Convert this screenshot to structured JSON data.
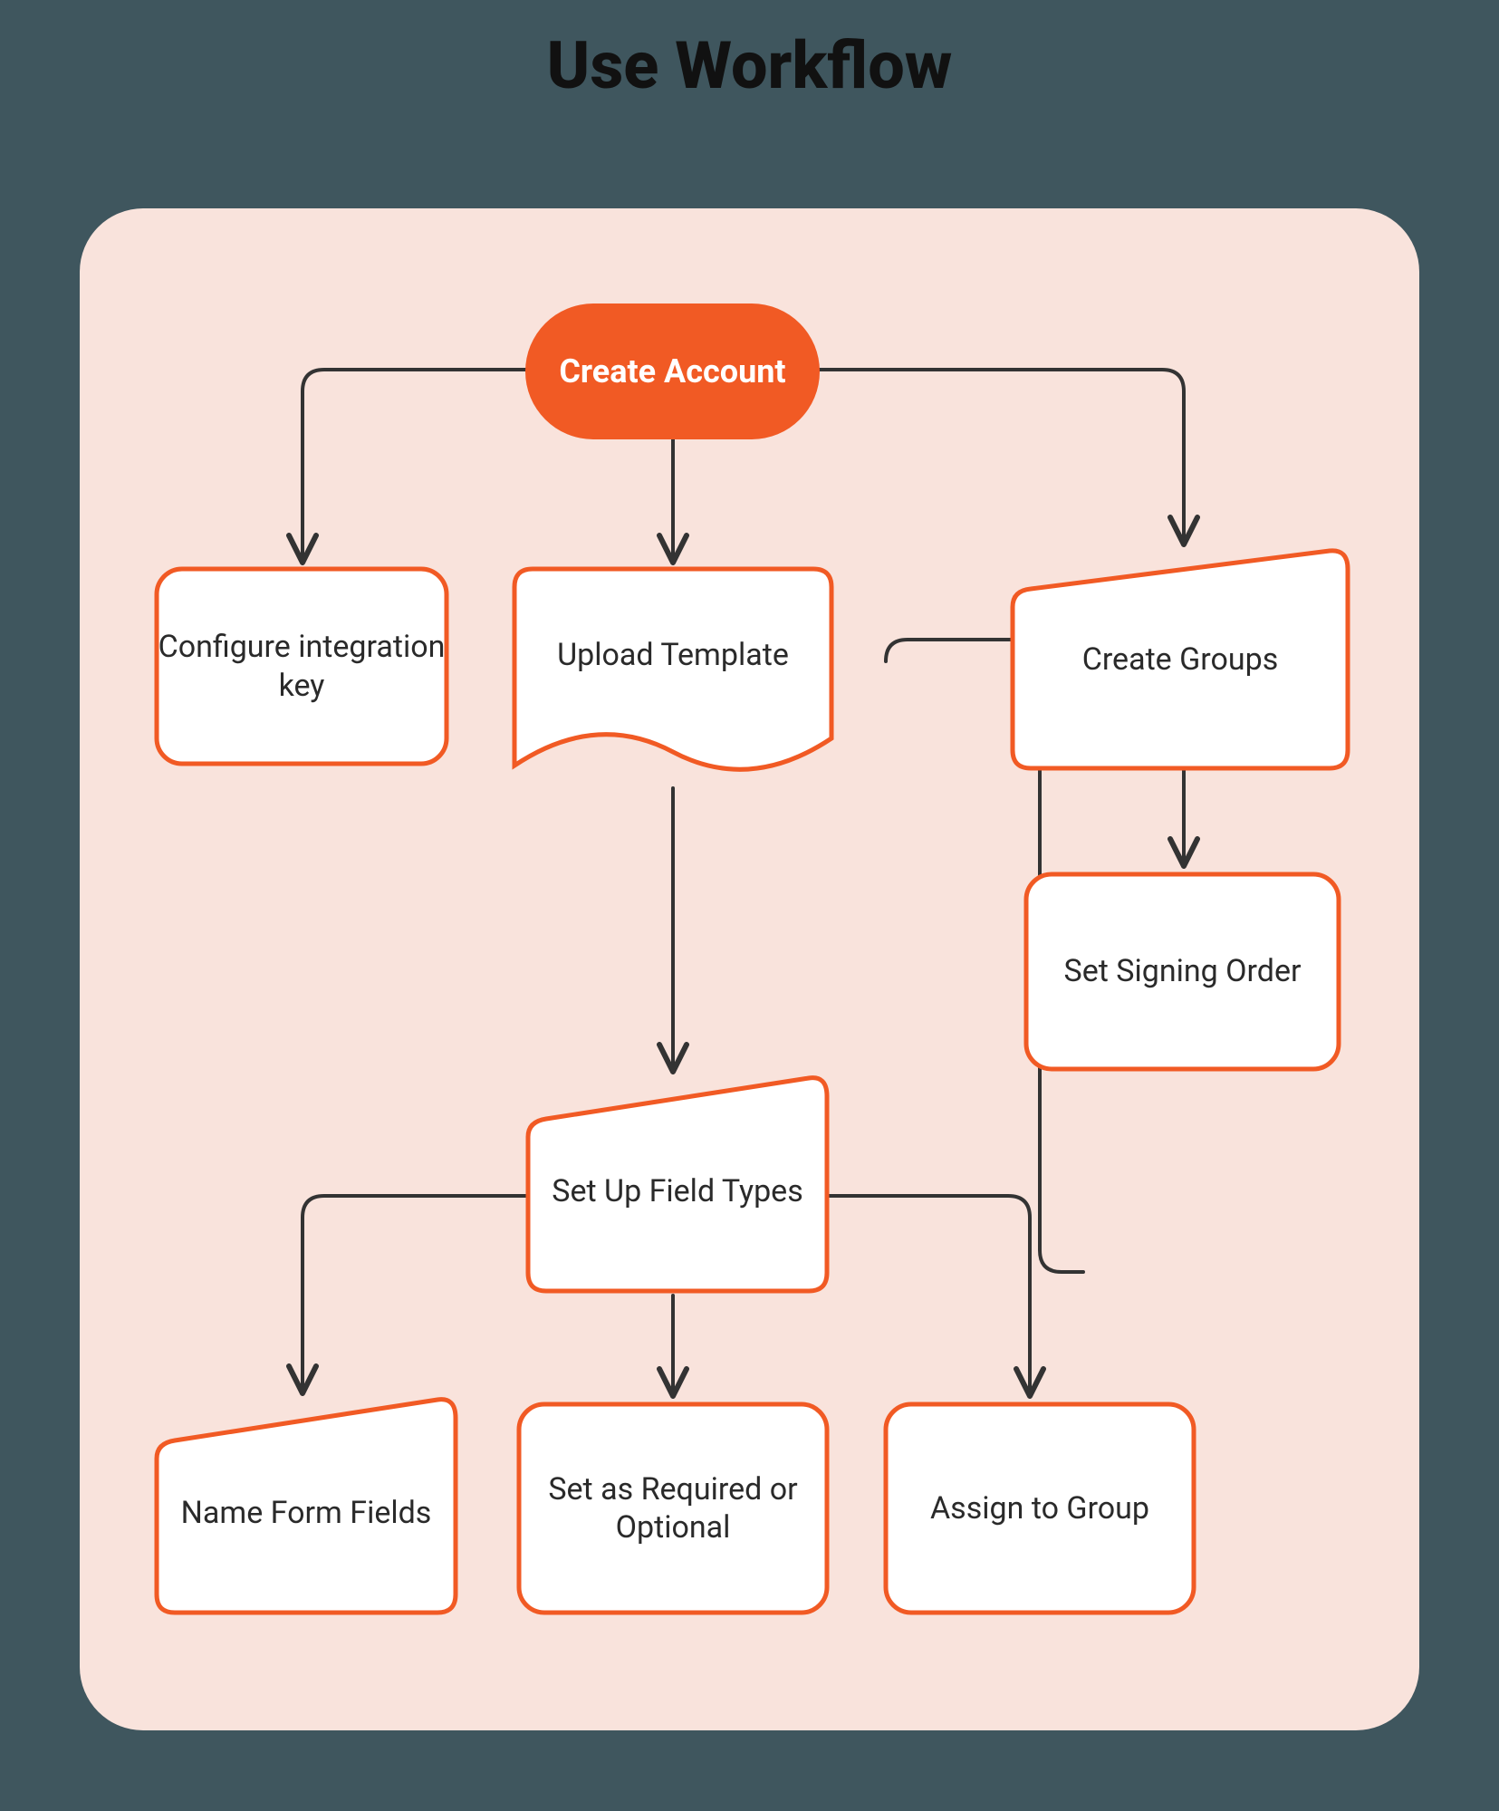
{
  "title": "Use Workflow",
  "colors": {
    "accent": "#F15A24",
    "panel": "#F9E3DC",
    "page_bg": "#3F565E",
    "connector": "#333333",
    "node_fill": "#FFFFFF"
  },
  "nodes": {
    "create_account": {
      "label": "Create Account",
      "shape": "pill-filled"
    },
    "configure_key": {
      "label": "Configure integration key",
      "shape": "rounded-rect"
    },
    "upload_template": {
      "label": "Upload Template",
      "shape": "document"
    },
    "create_groups": {
      "label": "Create Groups",
      "shape": "parallelogram"
    },
    "set_signing": {
      "label": "Set Signing Order",
      "shape": "rounded-rect"
    },
    "set_field_types": {
      "label": "Set Up Field Types",
      "shape": "parallelogram"
    },
    "name_fields": {
      "label": "Name Form Fields",
      "shape": "parallelogram"
    },
    "set_required": {
      "label": "Set as Required or Optional",
      "shape": "rounded-rect"
    },
    "assign_group": {
      "label": "Assign to Group",
      "shape": "rounded-rect"
    }
  },
  "edges": [
    {
      "from": "create_account",
      "to": "configure_key"
    },
    {
      "from": "create_account",
      "to": "upload_template"
    },
    {
      "from": "create_account",
      "to": "create_groups"
    },
    {
      "from": "create_groups",
      "to": "set_signing"
    },
    {
      "from": "upload_template",
      "to": "set_field_types"
    },
    {
      "from": "set_field_types",
      "to": "name_fields"
    },
    {
      "from": "set_field_types",
      "to": "set_required"
    },
    {
      "from": "set_field_types",
      "to": "assign_group"
    },
    {
      "from": "create_groups",
      "to": "assign_group",
      "implied": true
    }
  ]
}
